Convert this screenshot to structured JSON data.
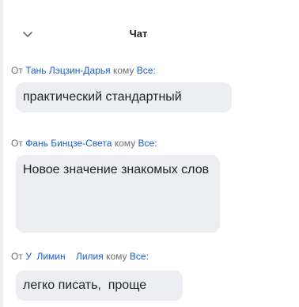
{
  "chat": {
    "title": "Чат",
    "messages": [
      {
        "from_prefix": "От",
        "sender": "Тань Лэцзин-Дарья",
        "to_prefix": "кому",
        "recipient": "Все:",
        "text": "практический  стандартный"
      },
      {
        "from_prefix": "От",
        "sender": "Фань Бинцзе-Света",
        "to_prefix": "кому",
        "recipient": "Все:",
        "text": "Новое значение знакомых слов"
      },
      {
        "from_prefix": "От",
        "sender": "У  Лимин    Лилия",
        "to_prefix": "кому",
        "recipient": "Все:",
        "text": "легко писать,  проще"
      }
    ]
  }
}
